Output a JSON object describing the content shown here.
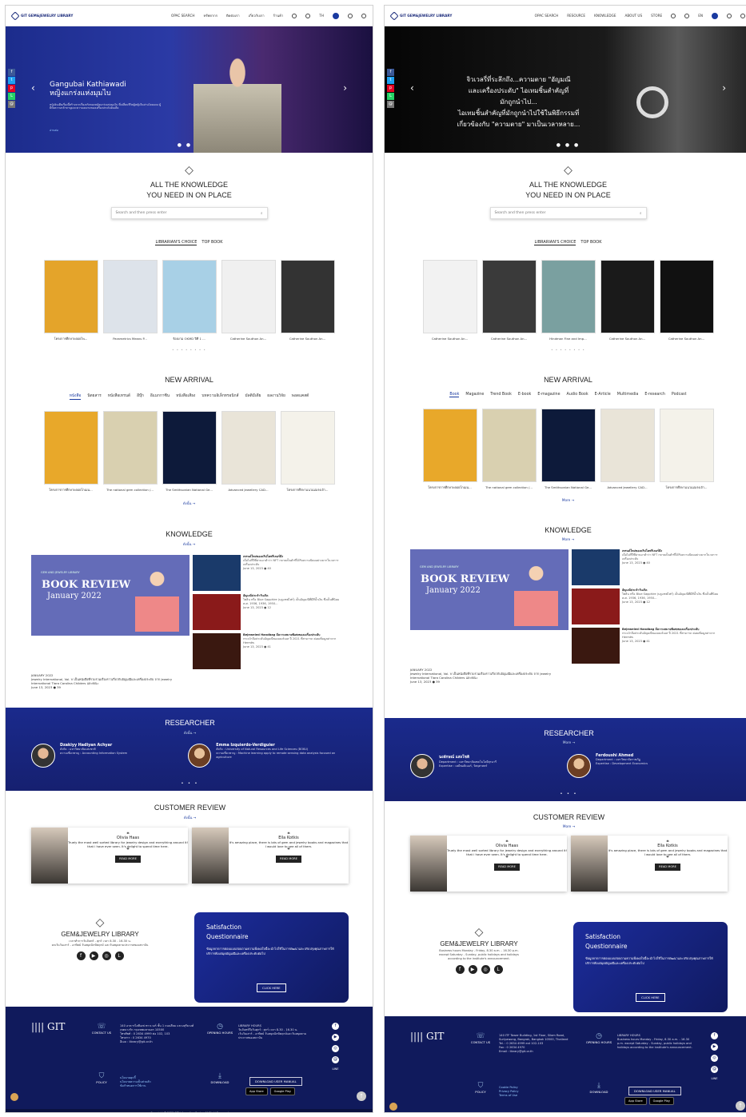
{
  "left": {
    "nav": {
      "brand": "GIT GEM&JEWELRY LIBRARY",
      "items": [
        "OPAC SEARCH",
        "ทรัพยากร",
        "ติดต่อเรา",
        "เกี่ยวกับเรา",
        "ร้านค้า",
        "TH"
      ]
    },
    "hero": {
      "title": "Gangubai Kathiawadi\nหญิงแกร่งแห่งมุมไบ",
      "text": "หนังอินเดียเรื่องนี้สร้างจากเรื่องจริงของหญิงแกร่งแห่งมุมไบ ที่เปลี่ยนชีวิตผู้หญิงในย่านโคมแดง ผู้มีทั้งความกล้าหาญและความงดงามของเครื่องประดับอินเดีย",
      "more": "อ่านต่อ"
    },
    "know_title": "ALL THE KNOWLEDGE\nYOU NEED IN ON PLACE",
    "search_placeholder": "Search and then press enter",
    "tabs": [
      "LIBRARIAN'S CHOICE",
      "TOP BOOK"
    ],
    "choice_books": [
      "โครงการศึกษาพลอยไพ...",
      "Parametrics Means P...",
      "ร้อยงาม OKMD ปีที่ 1 ...",
      "Catherine Southon An...",
      "Catherine Southon An..."
    ],
    "choice_covers": [
      "#e4a42a",
      "#dde3ea",
      "#a8d0e6",
      "#f0f0f0",
      "#333"
    ],
    "new_arrival": "NEW ARRIVAL",
    "cats": [
      "หนังสือ",
      "นิตยสาร",
      "หนังสือเทรนด์",
      "อีบุ๊ก",
      "อีแมกกาซีน",
      "หนังสือเสียง",
      "บทความอิเล็กทรอนิกส์",
      "มัลติมีเดีย",
      "ผลงานวิจัย",
      "พอดแคสต์"
    ],
    "arrivals": [
      "โครงการการศึกษาพลอยโกเมน...",
      "The national gem collection /...",
      "The Smithsonian National Ge...",
      "Advanced Jewellery CAD...",
      "โครงการศึกษาแนวแม่แรงเจ้า..."
    ],
    "arrival_covers": [
      "#e8a82a",
      "#d9d0b0",
      "#0d1a3a",
      "#e9e4d8",
      "#f4f2ea"
    ],
    "more": "ดังนั้น →",
    "knowledge": "KNOWLEDGE",
    "kb": {
      "small": "GEM AND JEWELRY LIBRARY",
      "title": "BOOK REVIEW",
      "sub": "January 2022",
      "cap": "JANUARY 2022",
      "desc": "Jewelry International, Vol. V เป็นหนังสือที่รวบรวมเรื่องราวเกี่ยวกับอัญมณีและเครื่องประดับ จาก Jewelry International Tiara Carolina Childers และคณะ",
      "date": "June 13, 2023 ● 39"
    },
    "kitems": [
      {
        "title": "เทรนด์ใหม่ของคริปโตฟรีเจอร์ดึง",
        "text": "เมื่อไม่กี่ปีที่ผ่านมาคำว่า NFT กลายเป็นคำที่ได้รับความนิยมอย่างมากในวงการเครื่องประดับ",
        "date": "June 13, 2023 ● 40",
        "c": "#1a3a6a"
      },
      {
        "title": "อัญมณีประจำวันเกิด",
        "text": "ไพลิน หรือ Blue Sapphire (บลูแซฟไฟร์) เป็นอัญมณีที่มีสีน้ำเงิน ซึ่งเป็นที่นิยม ค.ศ. 1936, 1936, 1950...",
        "date": "June 13, 2023 ● 12",
        "c": "#8a1a1a"
      },
      {
        "title": "Bejeweled Handbag มีความหมายพิเศษของเครื่องประดับ",
        "text": "กระเป๋าถือประดับอัญมณีของเฮอร์เมส ปี 2021 ที่สามารถ ค่อยเพิ่มมูลค่าจาก Hermès",
        "date": "June 13, 2023 ● 41",
        "c": "#3a1810"
      }
    ],
    "researcher": "RESEARCHER",
    "res": [
      {
        "name": "Dzakiyy Hadiyan Achyar",
        "d": "สังกัด : มหาวิทยาลัยแห่งชาติ\nความเชี่ยวชาญ : Accounting Information System"
      },
      {
        "name": "Emma Izquierdo-Verdiguier",
        "d": "สังกัด : University of Natural Resources and Life Sciences (BOKU)\nความเชี่ยวชาญ : Machine learning apply to remote sensing data analysis focused on agriculture"
      }
    ],
    "review": "CUSTOMER REVIEW",
    "reviews": [
      {
        "name": "Olivia Haas",
        "text": "Truely the most well sorted library for jewelry design and everything around it! that i have ever seen. It's delight to spend time here."
      },
      {
        "name": "Ella Kotkis",
        "text": "It's amazing place, there is lots of gem and jewelry books and magazines that I would love to see all of them."
      }
    ],
    "read_more": "READ MORE",
    "lib": {
      "title": "GEM&JEWELRY LIBRARY",
      "desc": "เวลาทำการวันจันทร์ - ศุกร์ เวลา 8.30 - 16.30 น.\nยกเว้นวันเสาร์ - อาทิตย์ วันหยุดนักขัตฤกษ์ และวันหยุดตามประกาศของสถาบัน"
    },
    "sat": {
      "title": "Satisfaction\nQuestionnaire",
      "desc": "ข้อมูลจากการตอบแบบสอบถามความพึงพอใจนี้จะนำไปใช้ในการพัฒนาและปรับปรุงคุณภาพการให้บริการห้องสมุดอัญมณีและเครื่องประดับต่อไป",
      "btn": "CLICK HERE"
    },
    "footer": {
      "contact": "CONTACT US",
      "contact_d": "140 อาคารไอทีเอฟ ทาวเวอร์ ชั้น 1 ถนนสีลม แขวงสุริยวงศ์ เขตบางรัก กรุงเทพมหานคร 10500\nโทรศัพท์ : 0 2634 4999 ต่อ 102, 103\nโทรสาร : 0 2634 4970\nอีเมล : library@git.or.th",
      "hours": "OPENING HOURS",
      "hours_d": "LIBRARY HOURS\nวันจันทร์ถึงวันศุกร์ : ศุกร์ เวลา 8.30 - 16.30 น.\nเว้นวันเสาร์ - อาทิตย์ วันหยุดนักขัตฤกษ์และวันหยุดตามประกาศของสถาบัน",
      "policy": "POLICY",
      "policy_d": "นโยบายคุกกี้\nนโยบายความเป็นส่วนตัว\nข้อกำหนดการใช้งาน",
      "download": "DOWNLOAD",
      "manual": "DOWNLOAD USER MANUAL",
      "app": "App Store",
      "gplay": "Google Play",
      "line": "LINE",
      "copy": "Copyright © 2023 GIT Information Center. All Right Reserved."
    }
  },
  "right": {
    "nav": {
      "brand": "GIT GEM&JEWELRY LIBRARY",
      "items": [
        "OPAC SEARCH",
        "RESOURCE",
        "KNOWLEDGE",
        "ABOUT US",
        "STORE",
        "EN"
      ]
    },
    "hero": {
      "title": "จิวเวลรี่ที่ระลึกถึง...ความตาย \"อัญมณี\nและเครื่องประดับ\" ไอเทมชิ้นสำคัญที่\nมักถูกนำไป...\nไอเทมชิ้นสำคัญที่มักถูกนำไปใช้ในพิธีกรรมที่\nเกี่ยวข้องกับ \"ความตาย\" มาเป็นเวลาหลาย...",
      "sub": "อัญมณีและเครื่องประดับ ไอเทมชิ้นสำคัญที่มักถูกนำไปใช้ในพิธีกรรมที่เกี่ยวข้องกับ..."
    },
    "know_title": "ALL THE KNOWLEDGE\nYOU NEED IN ON PLACE",
    "search_placeholder": "Search and then press enter",
    "tabs": [
      "LIBRARIAN'S CHOICE",
      "TOP BOOK"
    ],
    "choice_books": [
      "Catherine Southon An...",
      "Catherine Southon An...",
      "Hindman Fine and Imp...",
      "Catherine Southon An...",
      "Catherine Southon An..."
    ],
    "choice_covers": [
      "#f2f2f2",
      "#3a3a3a",
      "#7aa0a0",
      "#1a1a1a",
      "#111"
    ],
    "new_arrival": "NEW ARRIVAL",
    "cats": [
      "Book",
      "Magazine",
      "Trend Book",
      "E-book",
      "E-magazine",
      "Audio Book",
      "E-Article",
      "Multimedia",
      "E-research",
      "Podcast"
    ],
    "arrivals": [
      "โครงการการศึกษาพลอยโกเมน...",
      "The national gem collection /...",
      "The Smithsonian National Ge...",
      "Advanced Jewellery CAD...",
      "โครงการศึกษาแนวแม่แรงเจ้า..."
    ],
    "arrival_covers": [
      "#e8a82a",
      "#d9d0b0",
      "#0d1a3a",
      "#e9e4d8",
      "#f4f2ea"
    ],
    "more": "More →",
    "knowledge": "KNOWLEDGE",
    "kb": {
      "small": "GEM AND JEWELRY LIBRARY",
      "title": "BOOK REVIEW",
      "sub": "January 2022",
      "cap": "JANUARY 2022",
      "desc": "Jewelry International, Vol. V เป็นหนังสือที่รวบรวมเรื่องราวเกี่ยวกับอัญมณีและเครื่องประดับ จาก Jewelry International Tiara Carolina Childers และคณะ",
      "date": "June 13, 2023 ● 39"
    },
    "kitems": [
      {
        "title": "เทรนด์ใหม่ของคริปโตฟรีเจอร์ดึง",
        "text": "เมื่อไม่กี่ปีที่ผ่านมาคำว่า NFT กลายเป็นคำที่ได้รับความนิยมอย่างมากในวงการเครื่องประดับ",
        "date": "June 13, 2023 ● 40",
        "c": "#1a3a6a"
      },
      {
        "title": "อัญมณีประจำวันเกิด",
        "text": "ไพลิน หรือ Blue Sapphire (บลูแซฟไฟร์) เป็นอัญมณีที่มีสีน้ำเงิน ซึ่งเป็นที่นิยม ค.ศ. 1936, 1936, 1950...",
        "date": "June 13, 2023 ● 12",
        "c": "#8a1a1a"
      },
      {
        "title": "Bejeweled Handbag มีความหมายพิเศษของเครื่องประดับ",
        "text": "กระเป๋าถือประดับอัญมณีของเฮอร์เมส ปี 2021 ที่สามารถ ค่อยเพิ่มมูลค่าจาก Hermès",
        "date": "June 13, 2023 ● 41",
        "c": "#3a1810"
      }
    ],
    "researcher": "RESEARCHER",
    "res": [
      {
        "name": "นงลักษณ์ แสงโชติ",
        "d": "Department : มหาวิทยาลัยเทคโนโลยีสุรนารี\nExpertise : เคมีพอลิเมอร์, วัสดุศาสตร์"
      },
      {
        "name": "Ferdoushi Ahmed",
        "d": "Department : มหาวิทยาลัยราชภัฏ\nExpertise : Development Economics"
      }
    ],
    "review": "CUSTOMER REVIEW",
    "reviews": [
      {
        "name": "Olivia Haas",
        "text": "Truely the most well sorted library for jewelry design and everything around it! that i have ever seen. It's delight to spend time here."
      },
      {
        "name": "Ella Kotkis",
        "text": "It's amazing place, there is lots of gem and jewelry books and magazines that I would love to see all of them."
      }
    ],
    "read_more": "READ MORE",
    "lib": {
      "title": "GEM&JEWELRY LIBRARY",
      "desc": "Business hours Monday - Friday, 8.30 a.m. - 16.30 p.m.\nexcept Saturday - Sunday, public holidays and holidays\naccording to the institute's announcement."
    },
    "sat": {
      "title": "Satisfaction\nQuestionnaire",
      "desc": "ข้อมูลจากการตอบแบบสอบถามความพึงพอใจนี้จะนำไปใช้ในการพัฒนาและปรับปรุงคุณภาพการให้บริการห้องสมุดอัญมณีและเครื่องประดับต่อไป",
      "btn": "CLICK HERE"
    },
    "footer": {
      "contact": "CONTACT US",
      "contact_d": "140 ITF Tower Building, 1st Floor, Silom Road, Suriyawong, Bangrak, Bangkok 10500, Thailand\nTel. : 0 2634 4999 ext 102-103\nFax : 0 2634 4970\nEmail : library@git.or.th",
      "hours": "OPENING HOURS",
      "hours_d": "LIBRARY HOURS\nBusiness hours Monday - Friday, 8.30 a.m. - 16.30 p.m. except Saturday - Sunday, public holidays and holidays according to the institute's announcement.",
      "policy": "POLICY",
      "policy_d": "Cookie Policy\nPrivacy Policy\nTerms of Use",
      "download": "DOWNLOAD",
      "manual": "DOWNLOAD USER MANUAL",
      "app": "App Store",
      "gplay": "Google Play",
      "line": "LINE",
      "copy": "Copyright © 2023 GIT Information Center. All Right Reserved."
    }
  }
}
